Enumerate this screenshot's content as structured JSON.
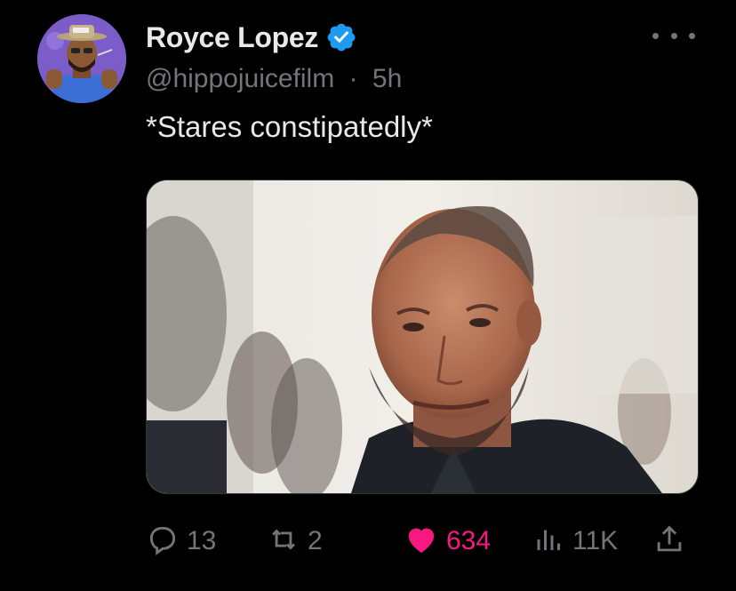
{
  "author": {
    "display_name": "Royce Lopez",
    "handle": "@hippojuicefilm",
    "separator": "·",
    "time_ago": "5h",
    "verified": true,
    "avatar_icon": "cartoon-avatar-hat-glasses"
  },
  "tweet": {
    "text": "*Stares constipatedly*",
    "media_description_icon": "photo-bald-man-in-suit"
  },
  "actions": {
    "reply": {
      "icon": "reply-icon",
      "count": "13"
    },
    "repost": {
      "icon": "repost-icon",
      "count": "2"
    },
    "like": {
      "icon": "heart-icon",
      "count": "634",
      "liked": true
    },
    "views": {
      "icon": "views-icon",
      "count": "11K"
    },
    "share": {
      "icon": "share-icon"
    }
  },
  "colors": {
    "background": "#000000",
    "text_primary": "#e7e9ea",
    "text_secondary": "#71767b",
    "verified_blue": "#1d9bf0",
    "like_pink": "#f91880"
  }
}
